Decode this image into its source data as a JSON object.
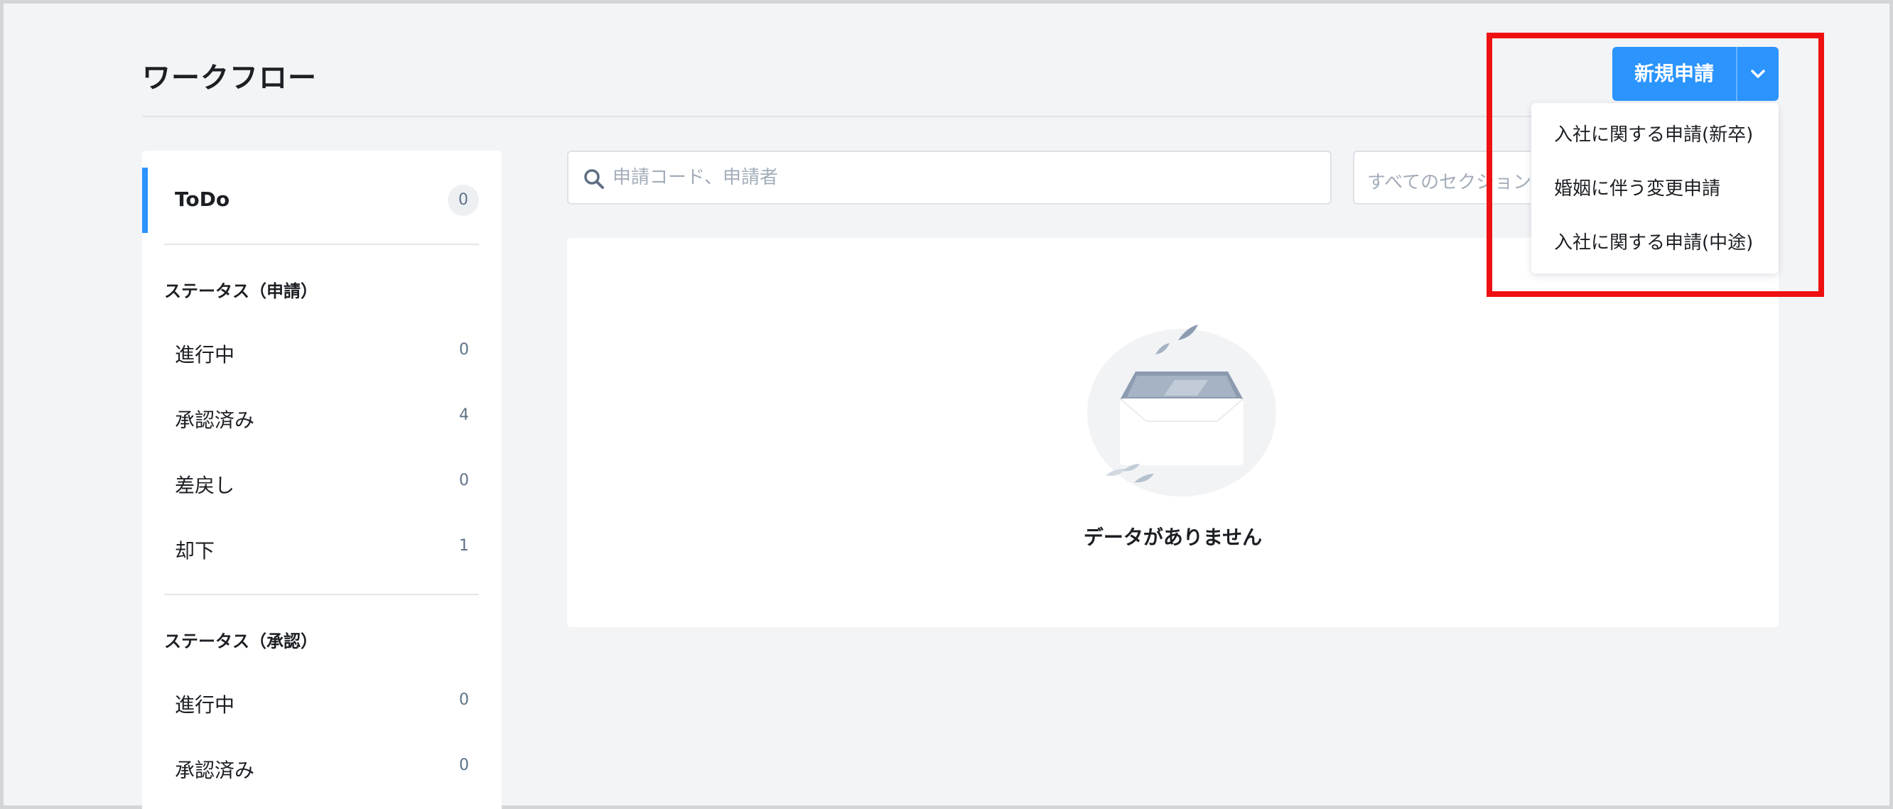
{
  "page": {
    "title": "ワークフロー"
  },
  "sidebar": {
    "todo": {
      "label": "ToDo",
      "count": "0"
    },
    "sections": [
      {
        "heading": "ステータス（申請）",
        "items": [
          {
            "label": "進行中",
            "count": "0"
          },
          {
            "label": "承認済み",
            "count": "4"
          },
          {
            "label": "差戻し",
            "count": "0"
          },
          {
            "label": "却下",
            "count": "1"
          }
        ]
      },
      {
        "heading": "ステータス（承認）",
        "items": [
          {
            "label": "進行中",
            "count": "0"
          },
          {
            "label": "承認済み",
            "count": "0"
          }
        ]
      }
    ]
  },
  "search": {
    "placeholder": "申請コード、申請者",
    "icon": "search-icon"
  },
  "section_filter": {
    "placeholder": "すべてのセクション"
  },
  "empty_state": {
    "message": "データがありません",
    "icon": "empty-inbox-icon"
  },
  "new_request": {
    "label": "新規申請",
    "menu": [
      "入社に関する申請(新卒)",
      "婚姻に伴う変更申請",
      "入社に関する申請(中途)"
    ]
  },
  "colors": {
    "accent": "#2b94fd",
    "highlight": "#ef1111",
    "background": "#f3f4f6",
    "count_text": "#5f7187"
  }
}
